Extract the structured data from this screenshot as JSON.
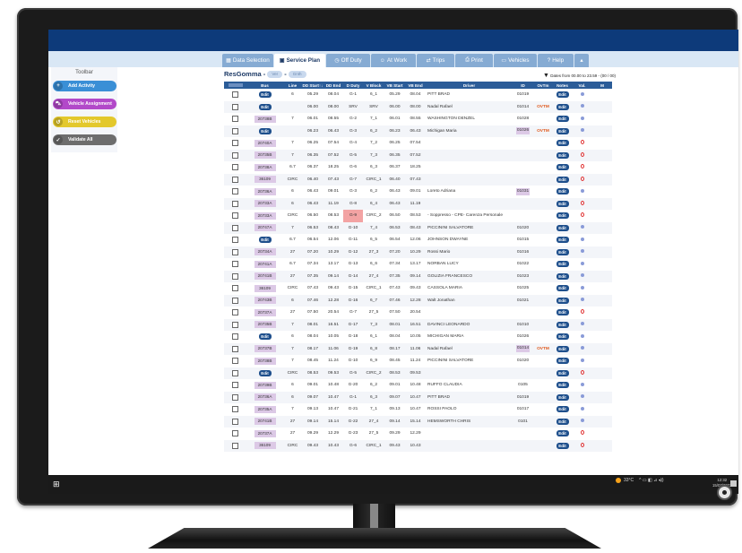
{
  "tabs": [
    {
      "label": "Data Selection",
      "icon": "table-icon"
    },
    {
      "label": "Service Plan",
      "icon": "document-icon",
      "active": true
    },
    {
      "label": "Off Duty",
      "icon": "clock-icon"
    },
    {
      "label": "At Work",
      "icon": "person-icon"
    },
    {
      "label": "Trips",
      "icon": "route-icon"
    },
    {
      "label": "Print",
      "icon": "print-icon"
    },
    {
      "label": "Vehicles",
      "icon": "bus-icon"
    },
    {
      "label": "Help",
      "icon": "help-icon"
    }
  ],
  "toolbar": {
    "title": "Toolbar",
    "buttons": [
      {
        "label": "Add Activity",
        "icon": "plus-icon",
        "color": "#3a8fd6"
      },
      {
        "label": "Vehicle Assignment",
        "icon": "car-icon",
        "color": "#b249c9"
      },
      {
        "label": "Reset Vehicles",
        "icon": "reset-icon",
        "color": "#e3c82c"
      },
      {
        "label": "Validate All",
        "icon": "check-icon",
        "color": "#6d6d6d"
      }
    ]
  },
  "main": {
    "title": "ResGomma -",
    "pill1": "Ver",
    "pill2": "Gnth",
    "filter": "Dates from 00.00 to 23.59 - (00 / 00)"
  },
  "columns": [
    "",
    "Bus",
    "Line",
    "DD Start",
    "DD End",
    "D Duty",
    "V Block",
    "VB Start",
    "VB End",
    "Driver",
    "ID",
    "OvTm",
    "Notes",
    "Val.",
    "M"
  ],
  "rows": [
    {
      "bus": "Edit",
      "line": "6",
      "dds": "05.29",
      "dde": "08.04",
      "duty": "G-1",
      "vb": "6_1",
      "vbs": "05.29",
      "vbe": "08.04",
      "driver": "PITT BRAD",
      "id": "01019",
      "ov": "",
      "val": "ok"
    },
    {
      "bus": "Edit",
      "line": "",
      "dds": "06.00",
      "dde": "08.00",
      "duty": "SRV",
      "vb": "SRV",
      "vbs": "06.00",
      "vbe": "08.00",
      "driver": "Nadal Rafael",
      "id": "01014",
      "ov": "OVTM",
      "val": "ok"
    },
    {
      "bus": "20738B",
      "line": "7",
      "dds": "06.01",
      "dde": "08.55",
      "duty": "G-2",
      "vb": "7_1",
      "vbs": "06.01",
      "vbe": "08.55",
      "driver": "WASHINGTON DENZEL",
      "id": "01028",
      "ov": "",
      "val": "ok"
    },
    {
      "bus": "Edit",
      "line": "",
      "dds": "06.23",
      "dde": "06.43",
      "duty": "G-3",
      "vb": "6_2",
      "vbs": "06.23",
      "vbe": "06.43",
      "driver": "Michigan Maria",
      "id": "01026",
      "idh": true,
      "ov": "OVTM",
      "val": "ok"
    },
    {
      "bus": "20740A",
      "line": "7",
      "dds": "06.25",
      "dde": "07.54",
      "duty": "G-4",
      "vb": "7_2",
      "vbs": "06.25",
      "vbe": "07.54",
      "driver": "",
      "id": "",
      "ov": "",
      "val": "bad"
    },
    {
      "bus": "20735B",
      "line": "7",
      "dds": "06.35",
      "dde": "07.52",
      "duty": "G-5",
      "vb": "7_3",
      "vbs": "06.35",
      "vbe": "07.52",
      "driver": "",
      "id": "",
      "ov": "",
      "val": "bad"
    },
    {
      "bus": "20738A",
      "line": "6.7",
      "dds": "06.37",
      "dde": "18.25",
      "duty": "G-6",
      "vb": "6_3",
      "vbs": "06.37",
      "vbe": "18.25",
      "driver": "",
      "id": "",
      "ov": "",
      "val": "bad"
    },
    {
      "bus": "36109",
      "line": "CIRC",
      "dds": "06.40",
      "dde": "07.43",
      "duty": "G-7",
      "vb": "CIRC_1",
      "vbs": "06.40",
      "vbe": "07.43",
      "driver": "",
      "id": "",
      "ov": "",
      "val": "bad"
    },
    {
      "bus": "20736A",
      "line": "6",
      "dds": "06.43",
      "dde": "09.01",
      "duty": "G-3",
      "vb": "6_2",
      "vbs": "06.43",
      "vbe": "09.01",
      "driver": "Loreto Adriana",
      "id": "01031",
      "idh": true,
      "ov": "",
      "val": "ok"
    },
    {
      "bus": "20733A",
      "line": "6",
      "dds": "06.43",
      "dde": "11.19",
      "duty": "G-8",
      "vb": "6_4",
      "vbs": "06.43",
      "vbe": "11.19",
      "driver": "",
      "id": "",
      "ov": "",
      "val": "bad"
    },
    {
      "bus": "20733A",
      "line": "CIRC",
      "dds": "06.50",
      "dde": "08.53",
      "duty": "G-9",
      "dutyRed": true,
      "vb": "CIRC_2",
      "vbs": "06.50",
      "vbe": "08.53",
      "driver": "- Soppresso - CPE- Carenza Personale",
      "id": "",
      "ov": "",
      "val": "bad"
    },
    {
      "bus": "20747A",
      "line": "7",
      "dds": "06.53",
      "dde": "08.43",
      "duty": "G-10",
      "vb": "7_4",
      "vbs": "06.53",
      "vbe": "08.43",
      "driver": "PICCININI SALVATORE",
      "id": "01020",
      "ov": "",
      "val": "ok"
    },
    {
      "bus": "Edit",
      "line": "6.7",
      "dds": "06.54",
      "dde": "12.06",
      "duty": "G-11",
      "vb": "6_5",
      "vbs": "06.54",
      "vbe": "12.06",
      "driver": "JOHNSON DWAYNE",
      "id": "01015",
      "ov": "",
      "val": "ok"
    },
    {
      "bus": "20734A",
      "line": "27",
      "dds": "07.20",
      "dde": "10.29",
      "duty": "G-12",
      "vb": "27_3",
      "vbs": "07.20",
      "vbe": "10.29",
      "driver": "Rossi Mario",
      "id": "01016",
      "ov": "",
      "val": "ok"
    },
    {
      "bus": "20741A",
      "line": "6.7",
      "dds": "07.34",
      "dde": "13.17",
      "duty": "G-13",
      "vb": "6_6",
      "vbs": "07.34",
      "vbe": "13.17",
      "driver": "NORBAN LUCY",
      "id": "01022",
      "ov": "",
      "val": "ok"
    },
    {
      "bus": "20741B",
      "line": "27",
      "dds": "07.35",
      "dde": "09.14",
      "duty": "G-14",
      "vb": "27_4",
      "vbs": "07.35",
      "vbe": "09.14",
      "driver": "GOLIZIA FRANCESCO",
      "id": "01023",
      "ov": "",
      "val": "ok"
    },
    {
      "bus": "36109",
      "line": "CIRC",
      "dds": "07.43",
      "dde": "09.43",
      "duty": "G-15",
      "vb": "CIRC_1",
      "vbs": "07.43",
      "vbe": "09.43",
      "driver": "CASSOLA MARIA",
      "id": "01025",
      "ov": "",
      "val": "ok"
    },
    {
      "bus": "20743B",
      "line": "6",
      "dds": "07.46",
      "dde": "12.28",
      "duty": "G-16",
      "vb": "6_7",
      "vbs": "07.46",
      "vbe": "12.28",
      "driver": "Walt Jonathan",
      "id": "01021",
      "ov": "",
      "val": "ok"
    },
    {
      "bus": "20737A",
      "line": "27",
      "dds": "07.50",
      "dde": "20.54",
      "duty": "G-7",
      "vb": "27_5",
      "vbs": "07.50",
      "vbe": "20.54",
      "driver": "",
      "id": "",
      "ov": "",
      "val": "bad"
    },
    {
      "bus": "20735B",
      "line": "7",
      "dds": "08.01",
      "dde": "16.51",
      "duty": "G-17",
      "vb": "7_3",
      "vbs": "08.01",
      "vbe": "16.51",
      "driver": "DAVINCI LEONARDO",
      "id": "01010",
      "ov": "",
      "val": "ok"
    },
    {
      "bus": "Edit",
      "line": "6",
      "dds": "08.04",
      "dde": "10.05",
      "duty": "G-18",
      "vb": "6_1",
      "vbs": "08.04",
      "vbe": "10.05",
      "driver": "MICHIGAN MARIA",
      "id": "01026",
      "ov": "",
      "val": "ok"
    },
    {
      "bus": "20737B",
      "line": "7",
      "dds": "08.17",
      "dde": "11.06",
      "duty": "G-19",
      "vb": "6_8",
      "vbs": "08.17",
      "vbe": "11.06",
      "driver": "Nadal Rafael",
      "id": "01014",
      "idh": true,
      "ov": "OVTM",
      "val": "ok"
    },
    {
      "bus": "20738B",
      "line": "7",
      "dds": "08.45",
      "dde": "11.24",
      "duty": "G-10",
      "vb": "6_9",
      "vbs": "08.45",
      "vbe": "11.24",
      "driver": "PICCININI SALVATORE",
      "id": "01020",
      "ov": "",
      "val": "ok"
    },
    {
      "bus": "Edit",
      "line": "CIRC",
      "dds": "08.53",
      "dde": "09.53",
      "duty": "G-5",
      "vb": "CIRC_2",
      "vbs": "08.53",
      "vbe": "09.53",
      "driver": "",
      "id": "",
      "ov": "",
      "val": "bad"
    },
    {
      "bus": "20739B",
      "line": "6",
      "dds": "09.01",
      "dde": "10.48",
      "duty": "G-20",
      "vb": "6_2",
      "vbs": "09.01",
      "vbe": "10.48",
      "driver": "RUFFO CLAUDIA",
      "id": "0105",
      "ov": "",
      "val": "ok"
    },
    {
      "bus": "20736A",
      "line": "6",
      "dds": "09.07",
      "dde": "10.47",
      "duty": "G-1",
      "vb": "6_3",
      "vbs": "09.07",
      "vbe": "10.47",
      "driver": "PITT BRAD",
      "id": "01019",
      "ov": "",
      "val": "ok"
    },
    {
      "bus": "20735A",
      "line": "7",
      "dds": "09.13",
      "dde": "10.47",
      "duty": "G-21",
      "vb": "7_1",
      "vbs": "09.13",
      "vbe": "10.47",
      "driver": "ROSSI PAOLO",
      "id": "01017",
      "ov": "",
      "val": "ok"
    },
    {
      "bus": "20741B",
      "line": "27",
      "dds": "09.14",
      "dde": "15.14",
      "duty": "G-22",
      "vb": "27_4",
      "vbs": "09.14",
      "vbe": "15.14",
      "driver": "HEMSWORTH CHRIS",
      "id": "0101",
      "ov": "",
      "val": "ok"
    },
    {
      "bus": "20737A",
      "line": "27",
      "dds": "09.29",
      "dde": "12.29",
      "duty": "G-23",
      "vb": "27_5",
      "vbs": "09.29",
      "vbe": "12.29",
      "driver": "",
      "id": "",
      "ov": "",
      "val": "bad"
    },
    {
      "bus": "36109",
      "line": "CIRC",
      "dds": "09.43",
      "dde": "10.43",
      "duty": "G-6",
      "vb": "CIRC_1",
      "vbs": "09.43",
      "vbe": "10.43",
      "driver": "",
      "id": "",
      "ov": "",
      "val": "bad"
    }
  ],
  "notes_label": "Edit",
  "taskbar": {
    "temp": "33°C",
    "time": "12:32",
    "date": "15/07/2023"
  }
}
